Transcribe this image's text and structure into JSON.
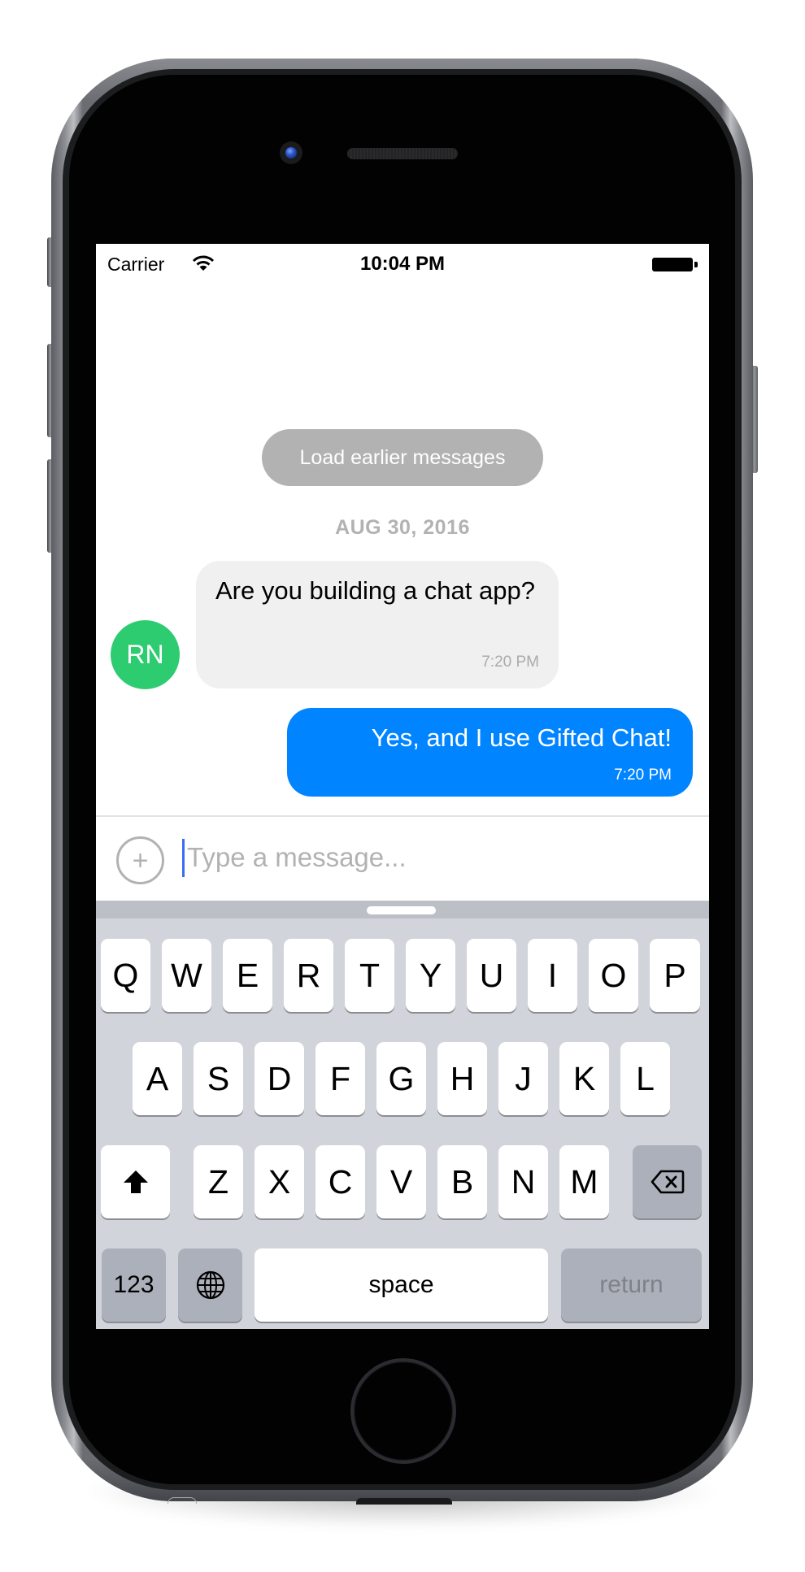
{
  "status_bar": {
    "carrier": "Carrier",
    "time": "10:04 PM",
    "wifi_icon": "wifi-icon",
    "battery_icon": "battery-icon"
  },
  "chat": {
    "load_earlier_label": "Load earlier messages",
    "day_label": "AUG 30, 2016",
    "messages": [
      {
        "side": "left",
        "avatar_initials": "RN",
        "text": "Are you building a chat app?",
        "time": "7:20 PM"
      },
      {
        "side": "right",
        "text": "Yes, and I use Gifted Chat!",
        "time": "7:20 PM"
      }
    ]
  },
  "composer": {
    "actions_icon": "plus-circle-icon",
    "actions_glyph": "+",
    "placeholder": "Type a message...",
    "value": ""
  },
  "keyboard": {
    "row1": [
      "Q",
      "W",
      "E",
      "R",
      "T",
      "Y",
      "U",
      "I",
      "O",
      "P"
    ],
    "row2": [
      "A",
      "S",
      "D",
      "F",
      "G",
      "H",
      "J",
      "K",
      "L"
    ],
    "row3": [
      "Z",
      "X",
      "C",
      "V",
      "B",
      "N",
      "M"
    ],
    "shift_icon": "shift-arrow-icon",
    "delete_icon": "backspace-icon",
    "numbers_label": "123",
    "globe_icon": "globe-icon",
    "space_label": "space",
    "return_label": "return"
  },
  "colors": {
    "outgoing_bubble": "#0084ff",
    "incoming_bubble": "#f0f0f0",
    "avatar": "#2ecc71",
    "load_earlier": "#b2b2b2",
    "keyboard_bg": "#d1d4da",
    "dark_key": "#acb0ba"
  }
}
